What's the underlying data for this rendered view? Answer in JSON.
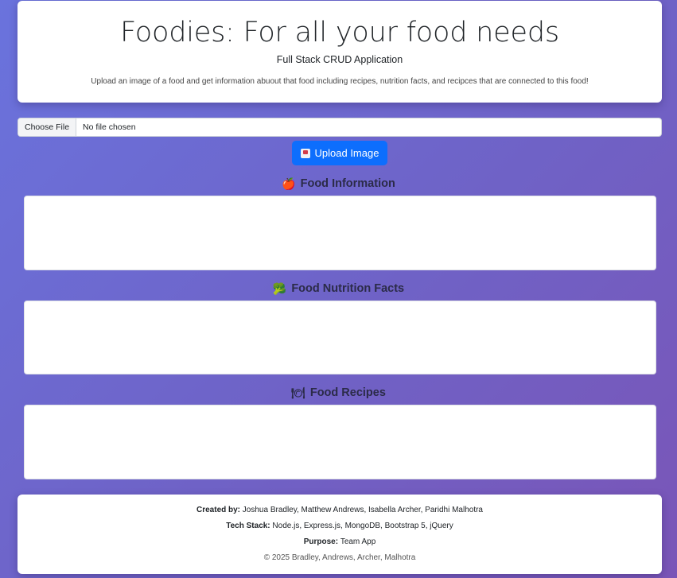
{
  "header": {
    "title": "Foodies: For all your food needs",
    "subtitle": "Full Stack CRUD Application",
    "description": "Upload an image of a food and get information abuout that food including recipes, nutrition facts, and recipces that are connected to this food!"
  },
  "upload": {
    "choose_label": "Choose File",
    "file_status": "No file chosen",
    "button_label": "Upload Image",
    "button_icon": "upload-icon"
  },
  "sections": [
    {
      "icon": "🍎",
      "icon_name": "apple-icon",
      "title": "Food Information"
    },
    {
      "icon": "🥦",
      "icon_name": "broccoli-icon",
      "title": "Food Nutrition Facts"
    },
    {
      "icon": "🍽",
      "icon_name": "plate-icon",
      "title": "Food Recipes"
    }
  ],
  "footer": {
    "created_by_label": "Created by:",
    "created_by_value": "Joshua Bradley, Matthew Andrews, Isabella Archer, Paridhi Malhotra",
    "tech_stack_label": "Tech Stack:",
    "tech_stack_value": "Node.js, Express.js, MongoDB, Bootstrap 5, jQuery",
    "purpose_label": "Purpose:",
    "purpose_value": "Team App",
    "copyright": "© 2025 Bradley, Andrews, Archer, Malhotra"
  },
  "colors": {
    "accent": "#0d6efd",
    "background_start": "#6a73dd",
    "background_end": "#7a55b7"
  }
}
